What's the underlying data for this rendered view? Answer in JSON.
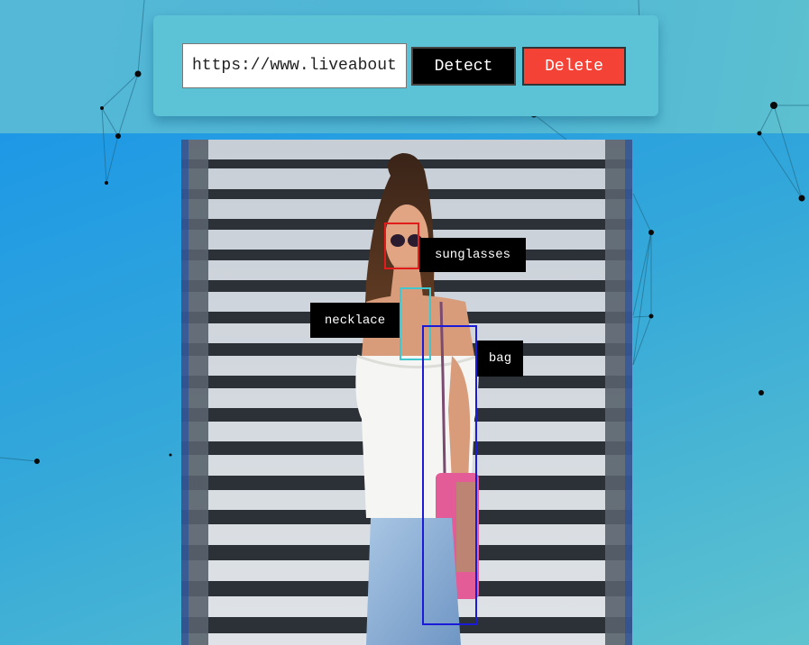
{
  "toolbar": {
    "url_value": "https://www.liveabout.com",
    "detect_label": "Detect",
    "delete_label": "Delete"
  },
  "detections": [
    {
      "label": "sunglasses",
      "color": "#e21b1b"
    },
    {
      "label": "necklace",
      "color": "#40c8d0"
    },
    {
      "label": "bag",
      "color": "#1a1ad8"
    }
  ],
  "colors": {
    "delete_button": "#f44336",
    "detect_button": "#000000",
    "page_top": "#55b8d6",
    "page_main": "#1e98e6"
  }
}
